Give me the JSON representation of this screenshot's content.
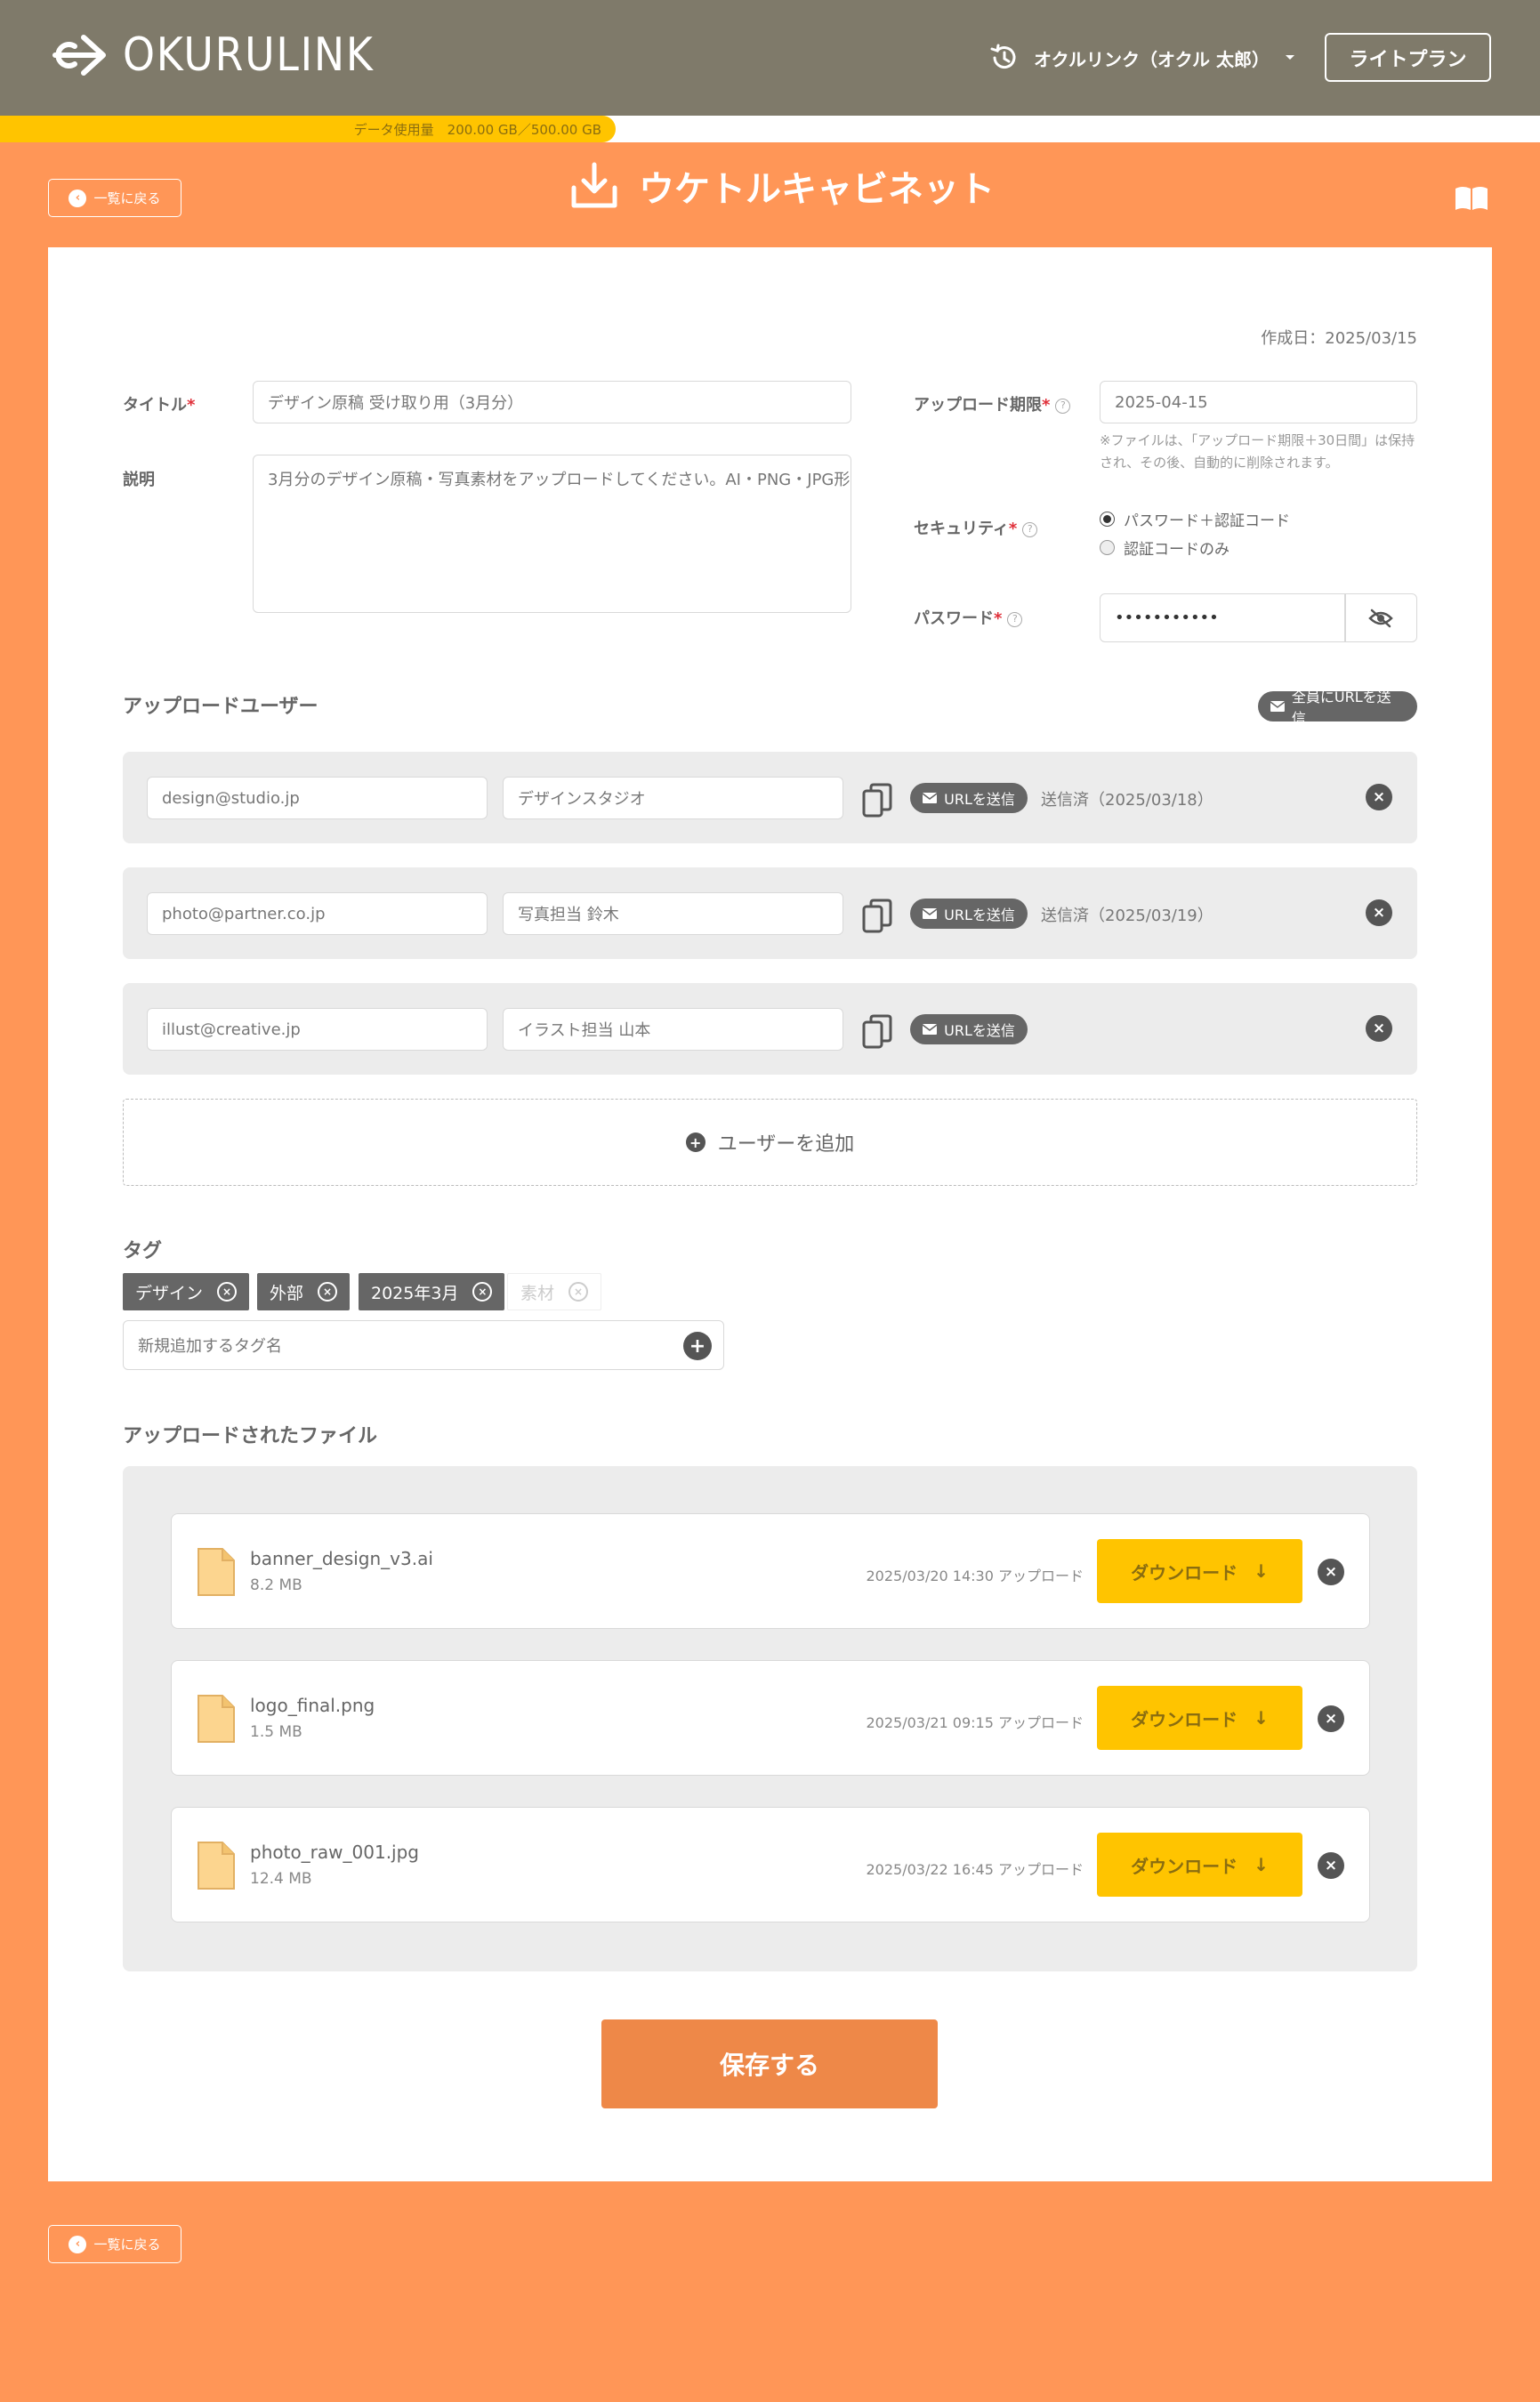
{
  "header": {
    "logo_text": "OKURULINK",
    "account_label": "オクルリンク（オクル 太郎）",
    "plan_label": "ライトプラン"
  },
  "usage": {
    "label": "データ使用量　200.00 GB／500.00 GB",
    "used_gb": 200,
    "total_gb": 500
  },
  "page": {
    "back_label": "一覧に戻る",
    "title": "ウケトルキャビネット",
    "created": "作成日：2025/03/15"
  },
  "form": {
    "title_label": "タイトル",
    "title_value": "デザイン原稿 受け取り用（3月分）",
    "desc_label": "説明",
    "desc_value": "3月分のデザイン原稿・写真素材をアップロードしてください。AI・PNG・JPG形",
    "deadline_label": "アップロード期限",
    "deadline_value": "2025-04-15",
    "deadline_note": "※ファイルは、「アップロード期限＋30日間」は保持され、その後、自動的に削除されます。",
    "security_label": "セキュリティ",
    "security_options": [
      "パスワード＋認証コード",
      "認証コードのみ"
    ],
    "security_selected": 0,
    "password_label": "パスワード",
    "password_value": "•••••••••••"
  },
  "users": {
    "section_label": "アップロードユーザー",
    "send_all_label": "全員にURLを送信",
    "send_label": "URLを送信",
    "add_label": "ユーザーを追加",
    "rows": [
      {
        "email": "design@studio.jp",
        "name": "デザインスタジオ",
        "status": "送信済（2025/03/18）"
      },
      {
        "email": "photo@partner.co.jp",
        "name": "写真担当 鈴木",
        "status": "送信済（2025/03/19）"
      },
      {
        "email": "illust@creative.jp",
        "name": "イラスト担当 山本",
        "status": ""
      }
    ]
  },
  "tags": {
    "section_label": "タグ",
    "items": [
      {
        "label": "デザイン",
        "active": true
      },
      {
        "label": "外部",
        "active": true
      },
      {
        "label": "2025年3月",
        "active": true
      },
      {
        "label": "素材",
        "active": false
      }
    ],
    "new_placeholder": "新規追加するタグ名"
  },
  "files": {
    "section_label": "アップロードされたファイル",
    "download_label": "ダウンロード",
    "rows": [
      {
        "name": "banner_design_v3.ai",
        "size": "8.2 MB",
        "uploaded": "2025/03/20 14:30 アップロード"
      },
      {
        "name": "logo_final.png",
        "size": "1.5 MB",
        "uploaded": "2025/03/21 09:15 アップロード"
      },
      {
        "name": "photo_raw_001.jpg",
        "size": "12.4 MB",
        "uploaded": "2025/03/22 16:45 アップロード"
      }
    ]
  },
  "actions": {
    "save_label": "保存する"
  },
  "colors": {
    "header_bg": "#7f7a6a",
    "page_bg": "#ff9657",
    "accent_yellow": "#ffc400",
    "save_button": "#ee8848"
  },
  "icons": [
    "logo-arrow-icon",
    "history-icon",
    "chevron-down-icon",
    "download-tray-icon",
    "book-icon",
    "back-circle-icon",
    "help-icon",
    "eye-slash-icon",
    "mail-icon",
    "copy-icon",
    "close-icon",
    "plus-circle-icon",
    "file-icon",
    "arrow-down-icon"
  ]
}
